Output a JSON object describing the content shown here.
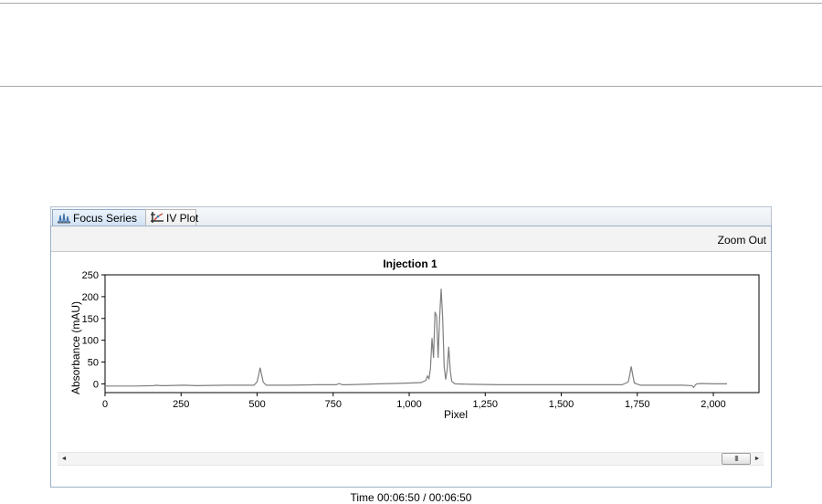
{
  "tabs": [
    {
      "label": "Focus Series",
      "icon": "focus-series-icon",
      "active": true
    },
    {
      "label": "IV Plot",
      "icon": "iv-plot-icon",
      "active": false
    }
  ],
  "toolbar": {
    "zoom_out_label": "Zoom Out"
  },
  "status": {
    "time_label": "Time 00:06:50 / 00:06:50"
  },
  "scrollbar": {
    "thumb_glyph": "III",
    "left_arrow": "◄",
    "right_arrow": "►"
  },
  "colors": {
    "trace": "#7f7f7f",
    "tab_active": "#cfe0f3",
    "border": "#9db1c9"
  },
  "chart_data": {
    "type": "line",
    "title": "Injection 1",
    "xlabel": "Pixel",
    "ylabel": "Absorbance (mAU)",
    "xlim": [
      0,
      2150
    ],
    "ylim": [
      -20,
      250
    ],
    "xticks": [
      0,
      250,
      500,
      750,
      1000,
      1250,
      1500,
      1750,
      2000
    ],
    "xtick_labels": [
      "0",
      "250",
      "500",
      "750",
      "1,000",
      "1,250",
      "1,500",
      "1,750",
      "2,000"
    ],
    "yticks": [
      0,
      50,
      100,
      150,
      200,
      250
    ],
    "ytick_labels": [
      "0",
      "50",
      "100",
      "150",
      "200",
      "250"
    ],
    "grid": false,
    "series": [
      {
        "x": [
          0,
          100,
          160,
          170,
          180,
          200,
          260,
          300,
          400,
          490,
          500,
          505,
          510,
          515,
          520,
          530,
          600,
          700,
          760,
          770,
          780,
          800,
          900,
          950,
          1000,
          1040,
          1055,
          1060,
          1065,
          1070,
          1075,
          1080,
          1085,
          1090,
          1095,
          1100,
          1105,
          1110,
          1115,
          1120,
          1125,
          1130,
          1135,
          1140,
          1150,
          1200,
          1300,
          1400,
          1500,
          1600,
          1700,
          1720,
          1725,
          1730,
          1735,
          1740,
          1760,
          1800,
          1900,
          1930,
          1935,
          1940,
          1945,
          1960,
          2000,
          2030,
          2045
        ],
        "y": [
          -5,
          -5,
          -4,
          -3,
          -4,
          -4,
          -3,
          -4,
          -3,
          -3,
          5,
          20,
          37,
          20,
          4,
          -3,
          -3,
          -2,
          -2,
          1,
          -2,
          -2,
          0,
          1,
          2,
          3,
          8,
          18,
          12,
          35,
          105,
          60,
          165,
          155,
          60,
          150,
          218,
          150,
          40,
          10,
          35,
          85,
          30,
          6,
          0,
          -1,
          -2,
          -2,
          -2,
          -2,
          -2,
          4,
          20,
          40,
          20,
          2,
          -3,
          -3,
          -3,
          -4,
          -8,
          -3,
          0,
          1,
          0,
          0,
          0
        ]
      }
    ]
  }
}
